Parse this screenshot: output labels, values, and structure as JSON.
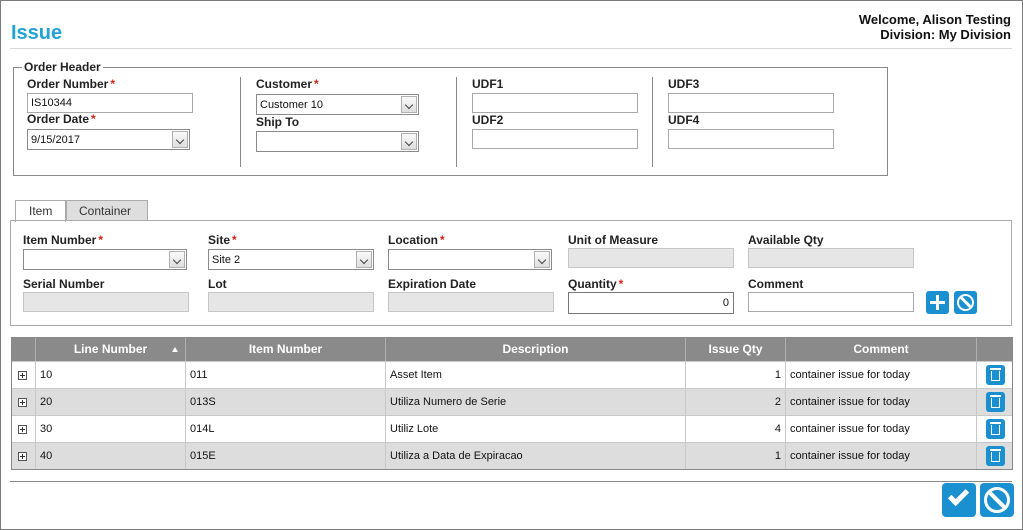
{
  "page": {
    "title": "Issue"
  },
  "user": {
    "welcome": "Welcome, Alison Testing",
    "division": "Division: My Division"
  },
  "order_header": {
    "legend": "Order Header",
    "order_number": {
      "label": "Order Number",
      "value": "IS10344"
    },
    "order_date": {
      "label": "Order Date",
      "value": "9/15/2017"
    },
    "customer": {
      "label": "Customer",
      "value": "Customer 10"
    },
    "ship_to": {
      "label": "Ship To",
      "value": ""
    },
    "udf1": {
      "label": "UDF1",
      "value": ""
    },
    "udf2": {
      "label": "UDF2",
      "value": ""
    },
    "udf3": {
      "label": "UDF3",
      "value": ""
    },
    "udf4": {
      "label": "UDF4",
      "value": ""
    },
    "required_marker": "*"
  },
  "tabs": [
    {
      "label": "Item"
    },
    {
      "label": "Container"
    }
  ],
  "item_form": {
    "item_number": {
      "label": "Item Number",
      "value": ""
    },
    "site": {
      "label": "Site",
      "value": "Site 2"
    },
    "location": {
      "label": "Location",
      "value": ""
    },
    "unit_of_measure": {
      "label": "Unit of Measure",
      "value": ""
    },
    "available_qty": {
      "label": "Available Qty",
      "value": ""
    },
    "serial_number": {
      "label": "Serial Number",
      "value": ""
    },
    "lot": {
      "label": "Lot",
      "value": ""
    },
    "expiration_date": {
      "label": "Expiration Date",
      "value": ""
    },
    "quantity": {
      "label": "Quantity",
      "value": "0"
    },
    "comment": {
      "label": "Comment",
      "value": ""
    }
  },
  "grid": {
    "columns": [
      "Line Number",
      "Item Number",
      "Description",
      "Issue Qty",
      "Comment"
    ],
    "rows": [
      {
        "line": "10",
        "item": "011",
        "description": "Asset Item",
        "qty": "1",
        "comment": "container issue for today"
      },
      {
        "line": "20",
        "item": "013S",
        "description": "Utiliza Numero de Serie",
        "qty": "2",
        "comment": "container issue for today"
      },
      {
        "line": "30",
        "item": "014L",
        "description": "Utiliz Lote",
        "qty": "4",
        "comment": "container issue for today"
      },
      {
        "line": "40",
        "item": "015E",
        "description": "Utiliza a Data de Expiracao",
        "qty": "1",
        "comment": "container issue for today"
      }
    ]
  },
  "colors": {
    "accent": "#1a90d0",
    "title": "#22a3d6",
    "required": "#dd2211",
    "header_bg": "#8a8a8a"
  }
}
